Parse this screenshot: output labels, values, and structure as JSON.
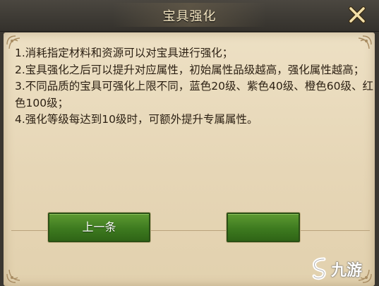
{
  "dialog": {
    "title": "宝具强化",
    "close_icon": "close-x-icon"
  },
  "description": {
    "lines": [
      "1.消耗指定材料和资源可以对宝具进行强化；",
      "2.宝具强化之后可以提升对应属性，初始属性品级越高，强化属性越高；",
      "3.不同品质的宝具可强化上限不同，蓝色20级、紫色40级、橙色60级、红色100级；",
      "4.强化等级每达到10级时，可额外提升专属属性。"
    ]
  },
  "buttons": {
    "prev_label": "上一条",
    "next_label": ""
  },
  "watermark": {
    "text": "九游",
    "icon": "jiuyou-logo-icon"
  },
  "colors": {
    "title_text": "#f4e6c2",
    "panel_bg": "#e6d6b6",
    "body_text": "#2b1f12",
    "button_green": "#3d7a1f"
  }
}
